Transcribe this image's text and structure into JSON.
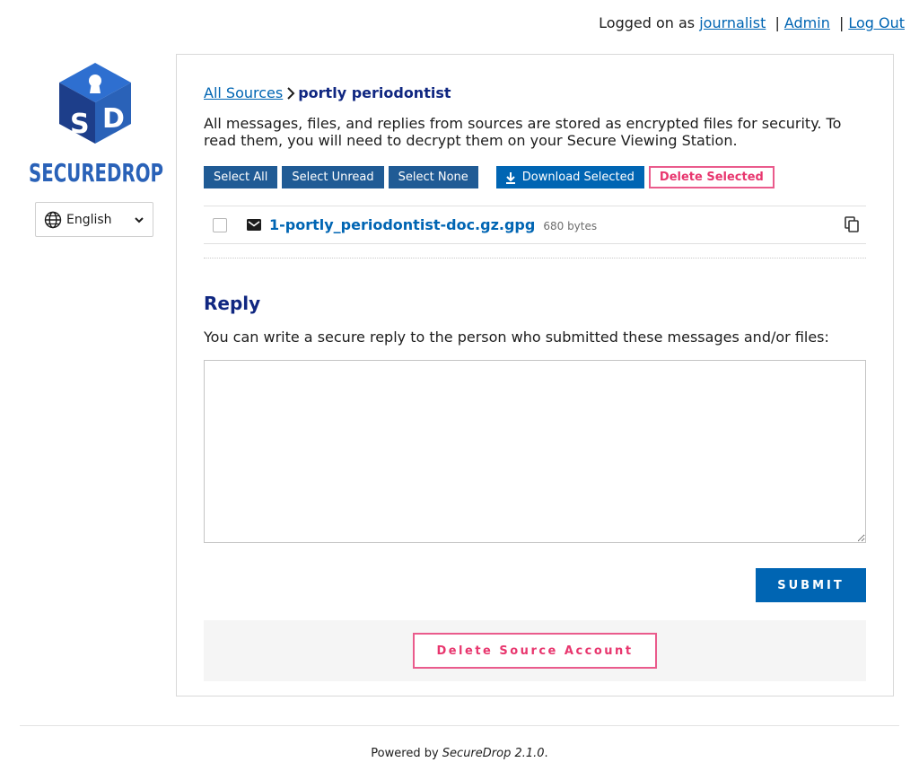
{
  "topbar": {
    "logged_in_prefix": "Logged on as",
    "username": "journalist",
    "separator": "|",
    "admin_link": "Admin",
    "logout_link": "Log Out"
  },
  "sidebar": {
    "logo_text": "SECUREDROP",
    "logo_letters": [
      "S",
      "D"
    ],
    "language": "English"
  },
  "breadcrumb": {
    "all_sources": "All Sources",
    "current": "portly periodontist"
  },
  "intro_text": "All messages, files, and replies from sources are stored as encrypted files for security. To read them, you will need to decrypt them on your Secure Viewing Station.",
  "actions": {
    "select_all": "Select All",
    "select_unread": "Select Unread",
    "select_none": "Select None",
    "download_selected": "Download Selected",
    "delete_selected": "Delete Selected"
  },
  "files": [
    {
      "name": "1-portly_periodontist-doc.gz.gpg",
      "size": "680 bytes",
      "icon": "envelope-icon"
    }
  ],
  "reply": {
    "title": "Reply",
    "description": "You can write a secure reply to the person who submitted these messages and/or files:",
    "value": "",
    "submit": "SUBMIT"
  },
  "danger": {
    "delete_source": "Delete Source Account"
  },
  "footer": {
    "powered_by": "Powered by",
    "product": "SecureDrop 2.1.0",
    "suffix": "."
  },
  "colors": {
    "brand_blue": "#0065b3",
    "dark_button": "#205b95",
    "heading_navy": "#102781",
    "danger_pink": "#e8366e",
    "logo_blue": "#2a62b8"
  }
}
